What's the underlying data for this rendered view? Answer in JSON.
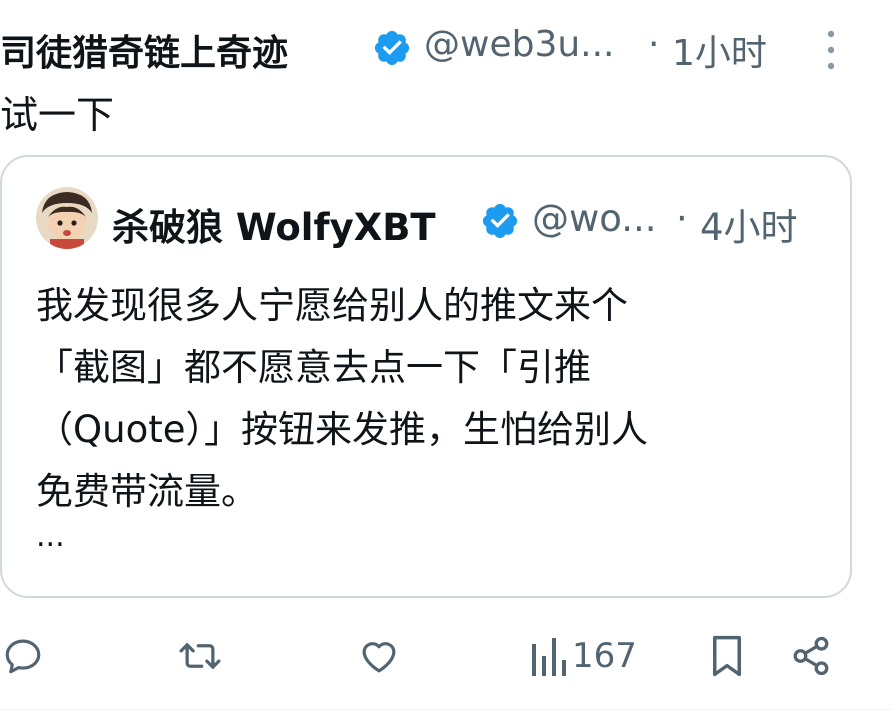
{
  "post": {
    "author_name": "司徒猎奇链上奇迹",
    "handle": "@web3u...",
    "separator": "·",
    "time": "1小时",
    "text": "试一下"
  },
  "quoted": {
    "author_name": "杀破狼 WolfyXBT",
    "handle": "@wo...",
    "separator": "·",
    "time": "4小时",
    "lines": [
      "我发现很多人宁愿给别人的推文来个",
      "「截图」都不愿意去点一下「引推",
      "（Quote）」按钮来发推，生怕给别人",
      "免费带流量。"
    ],
    "truncation": "..."
  },
  "actions": {
    "views_count": "167"
  },
  "colors": {
    "text": "#0f1419",
    "muted": "#536471",
    "verified": "#1d9bf0",
    "border": "#cfd9de"
  },
  "icons": {
    "verified": "verified-badge-icon",
    "more": "more-vertical-icon",
    "reply": "reply-icon",
    "repost": "repost-icon",
    "like": "heart-icon",
    "views": "views-icon",
    "bookmark": "bookmark-icon",
    "share": "share-icon"
  }
}
